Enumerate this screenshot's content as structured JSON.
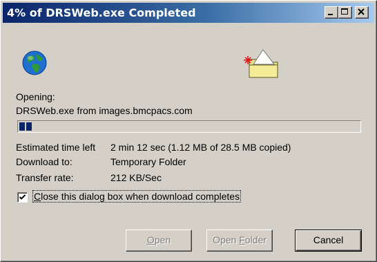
{
  "window": {
    "title": "4% of DRSWeb.exe Completed"
  },
  "titlebar_buttons": {
    "minimize": "minimize-icon",
    "maximize": "maximize-icon",
    "close": "close-icon"
  },
  "icons": {
    "globe": "globe-icon",
    "folder": "folder-icon"
  },
  "status": {
    "opening_label": "Opening:",
    "file_line": "DRSWeb.exe from images.bmcpacs.com",
    "progress_fraction": 0.04
  },
  "details": {
    "time_left_label": "Estimated time left",
    "time_left_value": "2 min 12 sec (1.12 MB of 28.5 MB copied)",
    "download_to_label": "Download to:",
    "download_to_value": "Temporary Folder",
    "transfer_rate_label": "Transfer rate:",
    "transfer_rate_value": "212 KB/Sec"
  },
  "options": {
    "close_on_complete_label": "Close this dialog box when download completes",
    "close_on_complete_checked": true
  },
  "buttons": {
    "open": "Open",
    "open_folder": "Open Folder",
    "cancel": "Cancel"
  },
  "colors": {
    "title_start": "#0a246a",
    "title_end": "#a6caf0",
    "face": "#d4d0c8",
    "progress": "#0a246a"
  }
}
